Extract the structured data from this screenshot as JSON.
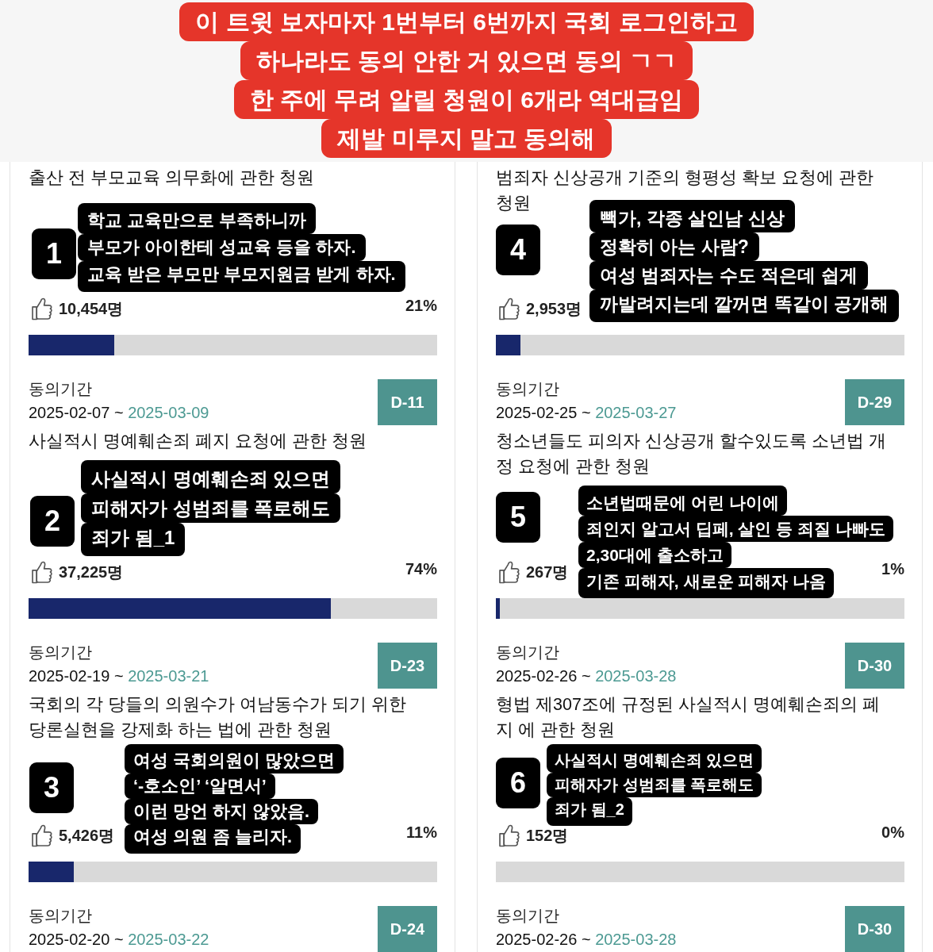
{
  "banner": {
    "lines": [
      "이 트윗 보자마자 1번부터 6번까지 국회 로그인하고",
      "하나라도 동의 안한 거 있으면 동의 ㄱㄱ",
      "한 주에 무려 알릴 청원이 6개라 역대급임",
      "제발 미루지 말고 동의해"
    ]
  },
  "columns": [
    {
      "petitions": [
        {
          "title_lines": [
            "출산 전 부모교육 의무화에 관한 청원"
          ],
          "number": "1",
          "caption_lines": [
            "학교 교육만으로 부족하니까",
            "부모가 아이한테 성교육 등을 하자.",
            "교육 받은 부모만 부모지원금 받게 하자."
          ],
          "supporters": "10,454명",
          "percent": "21%",
          "level": 0.21
        },
        {
          "period_label": "동의기간",
          "start_date": "2025-02-07",
          "date_separator": "~",
          "end_date": "2025-03-09",
          "d_day": "D-11",
          "title_lines": [
            "사실적시 명예훼손죄 폐지 요청에 관한 청원"
          ],
          "number": "2",
          "caption_lines": [
            "사실적시 명예훼손죄 있으면",
            "피해자가 성범죄를 폭로해도",
            "죄가 됨_1"
          ],
          "supporters": "37,225명",
          "percent": "74%",
          "level": 0.74
        },
        {
          "period_label": "동의기간",
          "start_date": "2025-02-19",
          "date_separator": "~",
          "end_date": "2025-03-21",
          "d_day": "D-23",
          "title_lines": [
            "국회의 각 당들의 의원수가 여남동수가 되기 위한",
            "당론실현을 강제화 하는 법에 관한 청원"
          ],
          "number": "3",
          "caption_lines": [
            "여성 국회의원이 많았으면",
            "‘-호소인’ ‘알면서’",
            "이런 망언 하지 않았음.",
            "여성 의원 좀 늘리자."
          ],
          "supporters": "5,426명",
          "percent": "11%",
          "level": 0.11
        },
        {
          "period_label": "동의기간",
          "start_date": "2025-02-20",
          "date_separator": "~",
          "end_date": "2025-03-22",
          "d_day": "D-24"
        }
      ]
    },
    {
      "petitions": [
        {
          "title_lines": [
            "범죄자 신상공개 기준의 형평성 확보 요청에 관한",
            "청원"
          ],
          "number": "4",
          "caption_lines": [
            "빽가, 각종 살인남 신상",
            "정확히 아는 사람?",
            "여성 범죄자는 수도 적은데 쉽게",
            "까발려지는데 깔꺼면 똑같이 공개해"
          ],
          "supporters": "2,953명",
          "level": 0.06
        },
        {
          "period_label": "동의기간",
          "start_date": "2025-02-25",
          "date_separator": "~",
          "end_date": "2025-03-27",
          "d_day": "D-29",
          "title_lines": [
            "청소년들도 피의자 신상공개 할수있도록 소년법 개",
            "정 요청에 관한 청원"
          ],
          "number": "5",
          "caption_lines": [
            "소년법때문에 어린 나이에",
            "죄인지 알고서 딥페, 살인 등 죄질 나빠도",
            "2,30대에 출소하고",
            "기존 피해자, 새로운 피해자 나옴"
          ],
          "supporters": "267명",
          "percent": "1%",
          "level": 0.01
        },
        {
          "period_label": "동의기간",
          "start_date": "2025-02-26",
          "date_separator": "~",
          "end_date": "2025-03-28",
          "d_day": "D-30",
          "title_lines": [
            "형법 제307조에 규정된 사실적시 명예훼손죄의 폐",
            "지 에 관한 청원"
          ],
          "number": "6",
          "caption_lines": [
            "사실적시 명예훼손죄 있으면",
            "피해자가 성범죄를 폭로해도",
            "죄가 됨_2"
          ],
          "supporters": "152명",
          "percent": "0%",
          "level": 0
        },
        {
          "period_label": "동의기간",
          "start_date": "2025-02-26",
          "date_separator": "~",
          "end_date": "2025-03-28",
          "d_day": "D-30"
        }
      ]
    }
  ]
}
